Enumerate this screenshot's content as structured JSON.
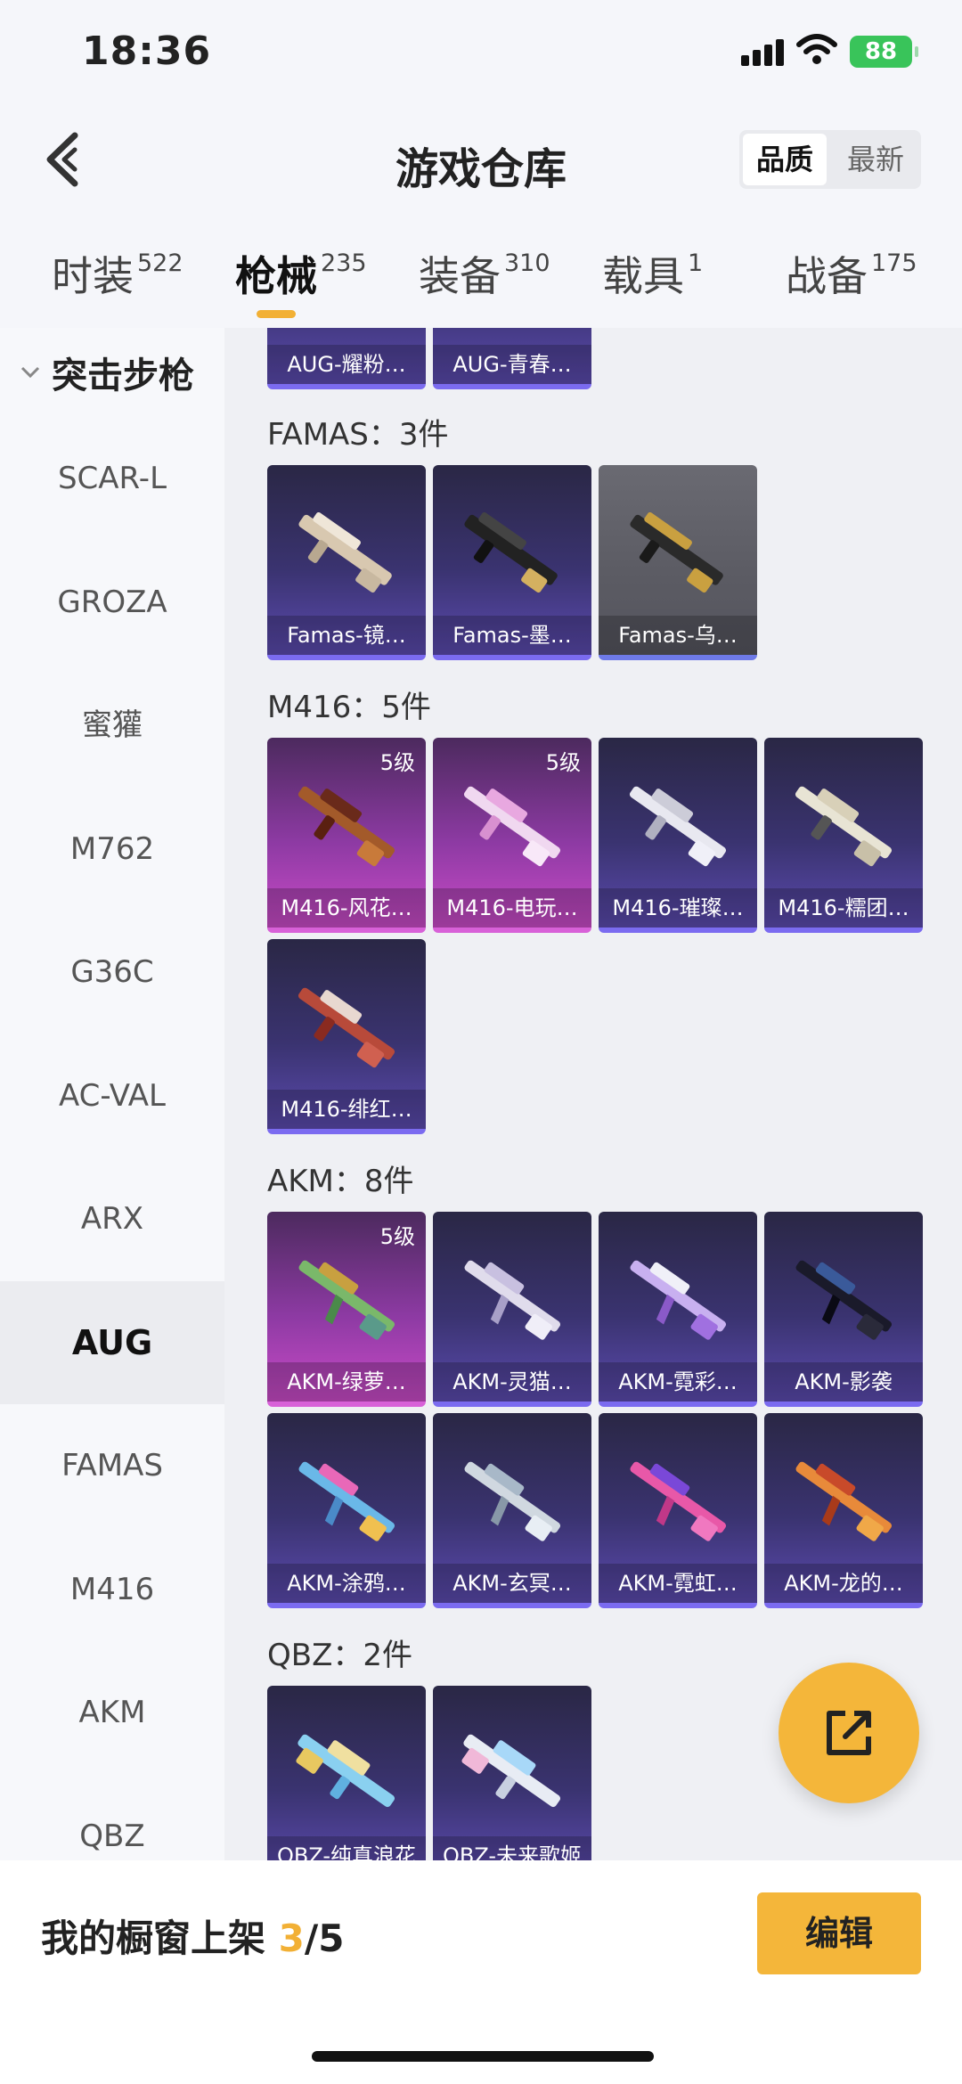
{
  "status_bar": {
    "time": "18:36",
    "battery": "88"
  },
  "nav": {
    "title": "游戏仓库",
    "sort_options": [
      "品质",
      "最新"
    ],
    "active_sort": "品质"
  },
  "tabs": [
    {
      "label": "时装",
      "count": "522"
    },
    {
      "label": "枪械",
      "count": "235"
    },
    {
      "label": "装备",
      "count": "310"
    },
    {
      "label": "载具",
      "count": "1"
    },
    {
      "label": "战备",
      "count": "175"
    }
  ],
  "sidebar": {
    "header": "突击步枪",
    "items": [
      "SCAR-L",
      "GROZA",
      "蜜獾",
      "M762",
      "G36C",
      "AC-VAL",
      "ARX",
      "AUG",
      "FAMAS",
      "M416",
      "AKM",
      "QBZ"
    ],
    "active": "AUG"
  },
  "sections": {
    "aug": {
      "cards": [
        "AUG-耀粉…",
        "AUG-青春…"
      ]
    },
    "famas": {
      "title": "FAMAS：3件",
      "cards": [
        "Famas-镜…",
        "Famas-墨…",
        "Famas-乌…"
      ]
    },
    "m416": {
      "title": "M416：5件",
      "cards": [
        "M416-风花…",
        "M416-电玩…",
        "M416-璀璨…",
        "M416-糯团…",
        "M416-绯红…"
      ]
    },
    "akm": {
      "title": "AKM：8件",
      "cards": [
        "AKM-绿萝…",
        "AKM-灵猫…",
        "AKM-霓彩…",
        "AKM-影袭",
        "AKM-涂鸦…",
        "AKM-玄冥…",
        "AKM-霓虹…",
        "AKM-龙的…"
      ]
    },
    "qbz": {
      "title": "QBZ：2件",
      "cards": [
        "QBZ-纯真浪花",
        "QBZ-未来歌姬"
      ]
    }
  },
  "level_badge": "5级",
  "bottom_bar": {
    "showcase_label": "我的橱窗上架",
    "showcase_count": "3",
    "showcase_total": "/5",
    "edit_label": "编辑"
  },
  "colors": {
    "accent": "#f4b63a",
    "card_purple": "#3a3370",
    "card_pink": "#8d3aa3"
  }
}
